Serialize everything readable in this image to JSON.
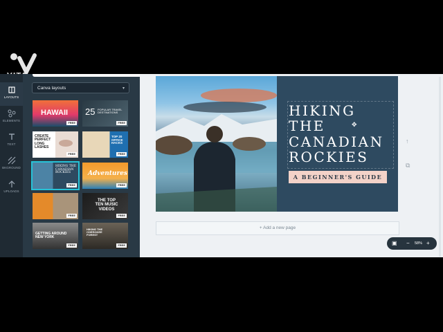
{
  "watermark": {
    "text": "VITA"
  },
  "rail": [
    {
      "label": "LAYOUTS",
      "icon": "layouts-icon",
      "active": true
    },
    {
      "label": "ELEMENTS",
      "icon": "elements-icon",
      "active": false
    },
    {
      "label": "TEXT",
      "icon": "text-icon",
      "active": false
    },
    {
      "label": "BKGROUND",
      "icon": "background-icon",
      "active": false
    },
    {
      "label": "UPLOADS",
      "icon": "uploads-icon",
      "active": false
    }
  ],
  "panel": {
    "dropdown": "Canva layouts",
    "free_label": "FREE",
    "thumbs": [
      {
        "text": "HAWAII"
      },
      {
        "number": "25",
        "text": "POPULAR TRAVEL DESTINATIONS"
      },
      {
        "text": "CREATE PERFECT LONG LASHES"
      },
      {
        "text": "TOP 20 OFFICE HACKS"
      },
      {
        "text": "HIKING THE CANADIAN ROCKIES"
      },
      {
        "text": "Adventures"
      },
      {
        "text": ""
      },
      {
        "text": "THE TOP TEN MUSIC VIDEOS"
      },
      {
        "text": "GETTING AROUND NEW YORK"
      },
      {
        "text": "HIKING THE CHEROKEE FOREST"
      }
    ]
  },
  "design": {
    "title_lines": [
      "HIKING",
      "THE",
      "CANADIAN",
      "ROCKIES"
    ],
    "subtitle": "A BEGINNER'S GUIDE"
  },
  "add_page": "+ Add a new page",
  "zoom": {
    "minus": "−",
    "value": "58%",
    "plus": "+"
  },
  "colors": {
    "panel": "#293945",
    "rail": "#1f2a33",
    "design_right": "#2e4a60",
    "subtitle_bg": "#f3d2c8"
  }
}
